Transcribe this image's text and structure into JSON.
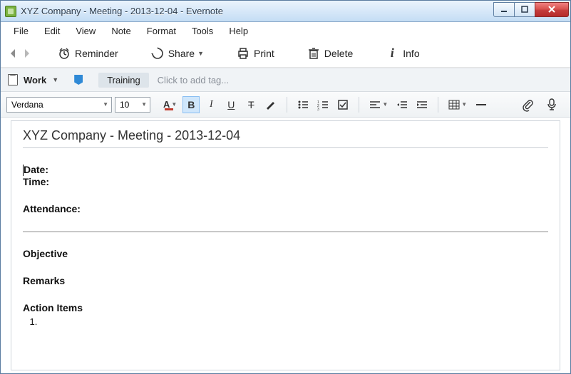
{
  "window": {
    "title": "XYZ Company - Meeting - 2013-12-04 - Evernote"
  },
  "menu": {
    "items": [
      "File",
      "Edit",
      "View",
      "Note",
      "Format",
      "Tools",
      "Help"
    ]
  },
  "toolbar": {
    "reminder": "Reminder",
    "share": "Share",
    "print": "Print",
    "delete": "Delete",
    "info": "Info"
  },
  "notebook": {
    "name": "Work",
    "tag": "Training",
    "tag_placeholder": "Click to add tag..."
  },
  "format": {
    "font": "Verdana",
    "size": "10",
    "bold_active": true
  },
  "note": {
    "title": "XYZ Company - Meeting - 2013-12-04",
    "fields": {
      "date_label": "Date:",
      "time_label": "Time:",
      "attendance_label": "Attendance:",
      "objective_label": "Objective",
      "remarks_label": "Remarks",
      "action_items_label": "Action Items"
    },
    "action_items": [
      "  "
    ]
  }
}
